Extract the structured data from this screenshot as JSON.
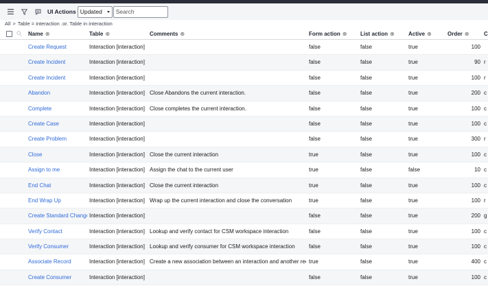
{
  "toolbar": {
    "title": "UI Actions",
    "select_value": "Updated",
    "search_placeholder": "Search"
  },
  "breadcrumb": {
    "all": "All",
    "separator": ">",
    "filter": "Table = interaction .or. Table in interaction"
  },
  "columns": {
    "name": "Name",
    "table": "Table",
    "comments": "Comments",
    "form_action": "Form action",
    "list_action": "List action",
    "active": "Active",
    "order": "Order",
    "condition": "C"
  },
  "rows": [
    {
      "name": "Create Request",
      "table": "Interaction [interaction]",
      "comments": "",
      "form": "false",
      "list": "false",
      "active": "true",
      "order": "100",
      "cond": ""
    },
    {
      "name": "Create Incident",
      "table": "Interaction [interaction]",
      "comments": "",
      "form": "false",
      "list": "false",
      "active": "true",
      "order": "90",
      "cond": "r"
    },
    {
      "name": "Create Incident",
      "table": "Interaction [interaction]",
      "comments": "",
      "form": "false",
      "list": "false",
      "active": "true",
      "order": "100",
      "cond": "r"
    },
    {
      "name": "Abandon",
      "table": "Interaction [interaction]",
      "comments": "Close Abandons the current interaction.",
      "form": "false",
      "list": "false",
      "active": "true",
      "order": "200",
      "cond": "c"
    },
    {
      "name": "Complete",
      "table": "Interaction [interaction]",
      "comments": "Close completes the current interaction.",
      "form": "false",
      "list": "false",
      "active": "true",
      "order": "100",
      "cond": "c"
    },
    {
      "name": "Create Case",
      "table": "Interaction [interaction]",
      "comments": "",
      "form": "false",
      "list": "false",
      "active": "true",
      "order": "100",
      "cond": "c"
    },
    {
      "name": "Create Problem",
      "table": "Interaction [interaction]",
      "comments": "",
      "form": "false",
      "list": "false",
      "active": "true",
      "order": "300",
      "cond": "r"
    },
    {
      "name": "Close",
      "table": "Interaction [interaction]",
      "comments": "Close the current interaction",
      "form": "true",
      "list": "false",
      "active": "true",
      "order": "100",
      "cond": "c"
    },
    {
      "name": "Assign to me",
      "table": "Interaction [interaction]",
      "comments": "Assign the chat to the current user",
      "form": "true",
      "list": "false",
      "active": "false",
      "order": "10",
      "cond": "c"
    },
    {
      "name": "End Chat",
      "table": "Interaction [interaction]",
      "comments": "Close the current interaction",
      "form": "true",
      "list": "false",
      "active": "true",
      "order": "100",
      "cond": "c"
    },
    {
      "name": "End Wrap Up",
      "table": "Interaction [interaction]",
      "comments": "Wrap up the current interaction and close the conversation",
      "form": "true",
      "list": "false",
      "active": "true",
      "order": "100",
      "cond": "r"
    },
    {
      "name": "Create Standard Change",
      "table": "Interaction [interaction]",
      "comments": "",
      "form": "false",
      "list": "false",
      "active": "true",
      "order": "200",
      "cond": "g"
    },
    {
      "name": "Verify Contact",
      "table": "Interaction [interaction]",
      "comments": "Lookup and verify contact for CSM workspace interaction",
      "form": "false",
      "list": "false",
      "active": "true",
      "order": "100",
      "cond": "c"
    },
    {
      "name": "Verify Consumer",
      "table": "Interaction [interaction]",
      "comments": "Lookup and verify consumer for CSM workspace interaction",
      "form": "false",
      "list": "false",
      "active": "true",
      "order": "100",
      "cond": "c"
    },
    {
      "name": "Associate Record",
      "table": "Interaction [interaction]",
      "comments": "Create a new association between an interaction and another record",
      "form": "true",
      "list": "false",
      "active": "true",
      "order": "400",
      "cond": "c"
    },
    {
      "name": "Create Consumer",
      "table": "Interaction [interaction]",
      "comments": "",
      "form": "false",
      "list": "false",
      "active": "true",
      "order": "100",
      "cond": "c"
    }
  ]
}
